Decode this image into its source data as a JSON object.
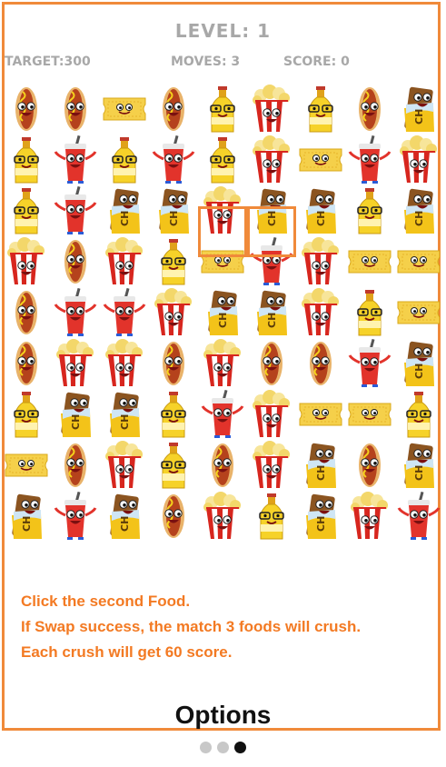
{
  "hud": {
    "level": "LEVEL:  1",
    "target": "TARGET:300",
    "moves": "MOVES: 3",
    "score": "SCORE:  0"
  },
  "board": {
    "rows": [
      [
        "hotdog",
        "hotdog",
        "ticket",
        "hotdog",
        "beer",
        "popcorn",
        "beer",
        "hotdog",
        "choc"
      ],
      [
        "beer",
        "soda",
        "beer",
        "soda",
        "beer",
        "popcorn",
        "ticket",
        "soda",
        "popcorn"
      ],
      [
        "beer",
        "soda",
        "choc",
        "choc",
        "popcorn",
        "choc",
        "choc",
        "beer",
        "choc"
      ],
      [
        "popcorn",
        "hotdog",
        "popcorn",
        "beer",
        "ticket",
        "soda",
        "popcorn",
        "ticket",
        "ticket"
      ],
      [
        "hotdog",
        "soda",
        "soda",
        "popcorn",
        "choc",
        "choc",
        "popcorn",
        "beer",
        "ticket"
      ],
      [
        "hotdog",
        "popcorn",
        "popcorn",
        "hotdog",
        "popcorn",
        "hotdog",
        "hotdog",
        "soda",
        "choc"
      ],
      [
        "beer",
        "choc",
        "choc",
        "beer",
        "soda",
        "popcorn",
        "ticket",
        "ticket",
        "beer"
      ],
      [
        "ticket",
        "hotdog",
        "popcorn",
        "beer",
        "hotdog",
        "popcorn",
        "choc",
        "hotdog",
        "choc"
      ],
      [
        "choc",
        "soda",
        "choc",
        "hotdog",
        "popcorn",
        "beer",
        "choc",
        "popcorn",
        "soda"
      ]
    ],
    "selected": [
      [
        2,
        4
      ],
      [
        2,
        5
      ]
    ]
  },
  "instructions": [
    "Click the second Food.",
    "If Swap success, the match 3 foods will crush.",
    "Each crush will get 60 score."
  ],
  "options_label": "Options",
  "pager": {
    "count": 3,
    "active": 2
  },
  "colors": {
    "accent": "#f08a3a",
    "text_orange": "#f37a23",
    "hud_gray": "#a8a8a8"
  }
}
